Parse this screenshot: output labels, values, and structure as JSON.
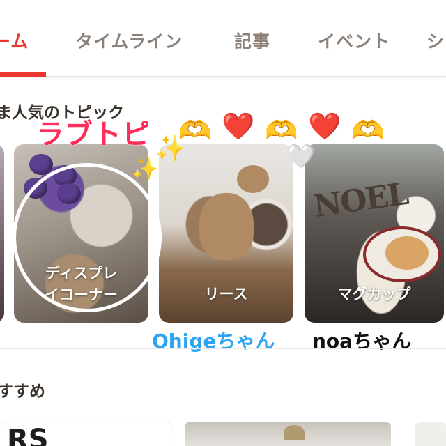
{
  "tabs": [
    {
      "label": "ーム",
      "active": true
    },
    {
      "label": "タイムライン",
      "active": false
    },
    {
      "label": "記事",
      "active": false
    },
    {
      "label": "イベント",
      "active": false
    },
    {
      "label": "シ",
      "active": false
    }
  ],
  "colors": {
    "accent": "#e9362e",
    "tab_inactive": "#8b8178",
    "sticker_pink": "#ff2d5a",
    "caption_blue": "#2da4f1"
  },
  "topics": {
    "title": "ま人気のトピック",
    "cards": [
      {
        "label_lines": [
          "ディスプレ",
          "イコーナー"
        ]
      },
      {
        "label": "リース"
      },
      {
        "label": "マグカップ"
      }
    ]
  },
  "stickers": {
    "title": "ラブトピ",
    "emoji": [
      "🫶",
      "❤️",
      "🫶",
      "❤️",
      "🫶",
      "✨",
      "✨",
      "🤍"
    ],
    "captions": [
      "Ohigeちゃん",
      "noaちゃん"
    ]
  },
  "photo_text": {
    "noel": "NOEL"
  },
  "recommend": {
    "title": "すすめ",
    "first_card_text": "RS"
  }
}
